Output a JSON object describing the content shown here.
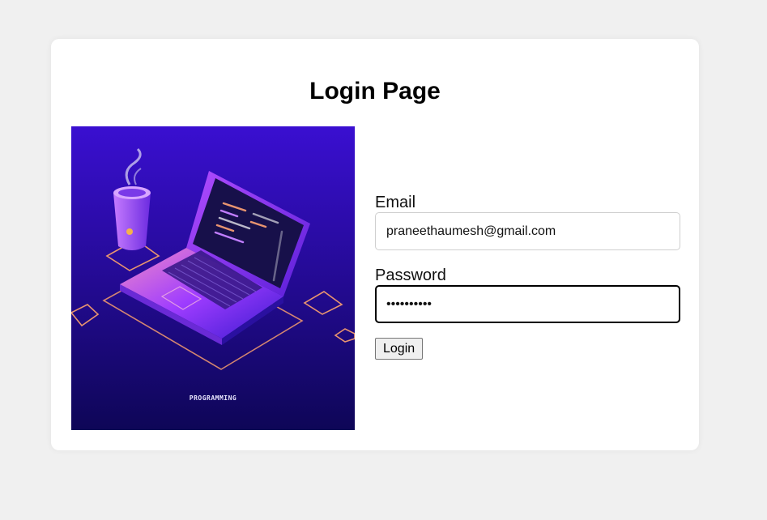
{
  "page": {
    "title": "Login Page"
  },
  "illustration": {
    "caption": "PROGRAMMING"
  },
  "form": {
    "email_label": "Email",
    "email_value": "praneethaumesh@gmail.com",
    "password_label": "Password",
    "password_value": "••••••••••",
    "login_label": "Login"
  },
  "colors": {
    "background": "#f0f0f0",
    "card": "#ffffff",
    "illustration_bg_top": "#3a0fd1",
    "illustration_bg_bottom": "#0e0657",
    "laptop_accent": "#9b3bff",
    "outline_accent": "#e8946f"
  }
}
